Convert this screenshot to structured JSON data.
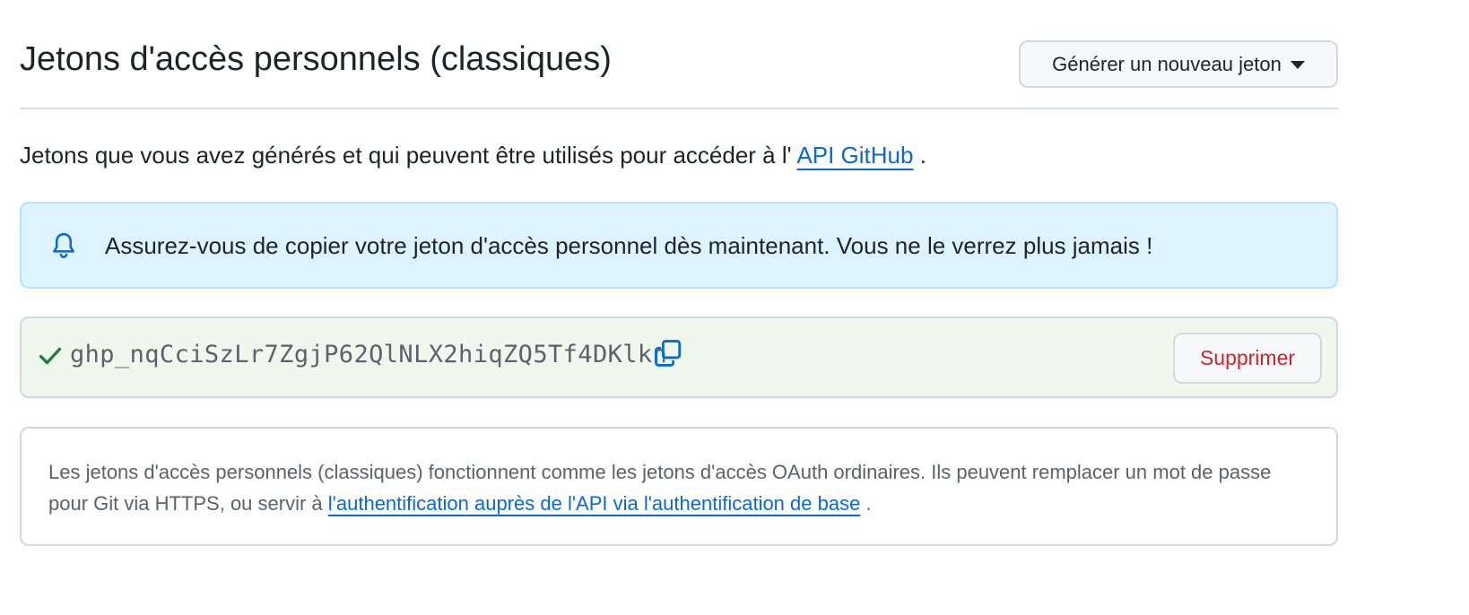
{
  "header": {
    "title": "Jetons d'accès personnels (classiques)",
    "generate_button_label": "Générer un nouveau jeton"
  },
  "description": {
    "prefix": "Jetons que vous avez générés et qui peuvent être utilisés pour accéder à l'",
    "link_text": "API GitHub",
    "suffix": "."
  },
  "flash": {
    "icon": "bell-icon",
    "message": "Assurez-vous de copier votre jeton d'accès personnel dès maintenant. Vous ne le verrez plus jamais !"
  },
  "token": {
    "status_icon": "check-icon",
    "value": "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",
    "copy_icon": "copy-icon",
    "delete_label": "Supprimer"
  },
  "info": {
    "text_prefix": "Les jetons d'accès personnels (classiques) fonctionnent comme les jetons d'accès OAuth ordinaires. Ils peuvent remplacer un mot de passe pour Git via HTTPS, ou servir à",
    "link_text": "l'authentification auprès de l'API via l'authentification de base",
    "suffix": "."
  },
  "colors": {
    "link": "#0969da",
    "danger": "#cf222e",
    "success": "#1a7f37",
    "info_bg": "#ddf4ff",
    "success_bg": "#f0f8ed"
  }
}
